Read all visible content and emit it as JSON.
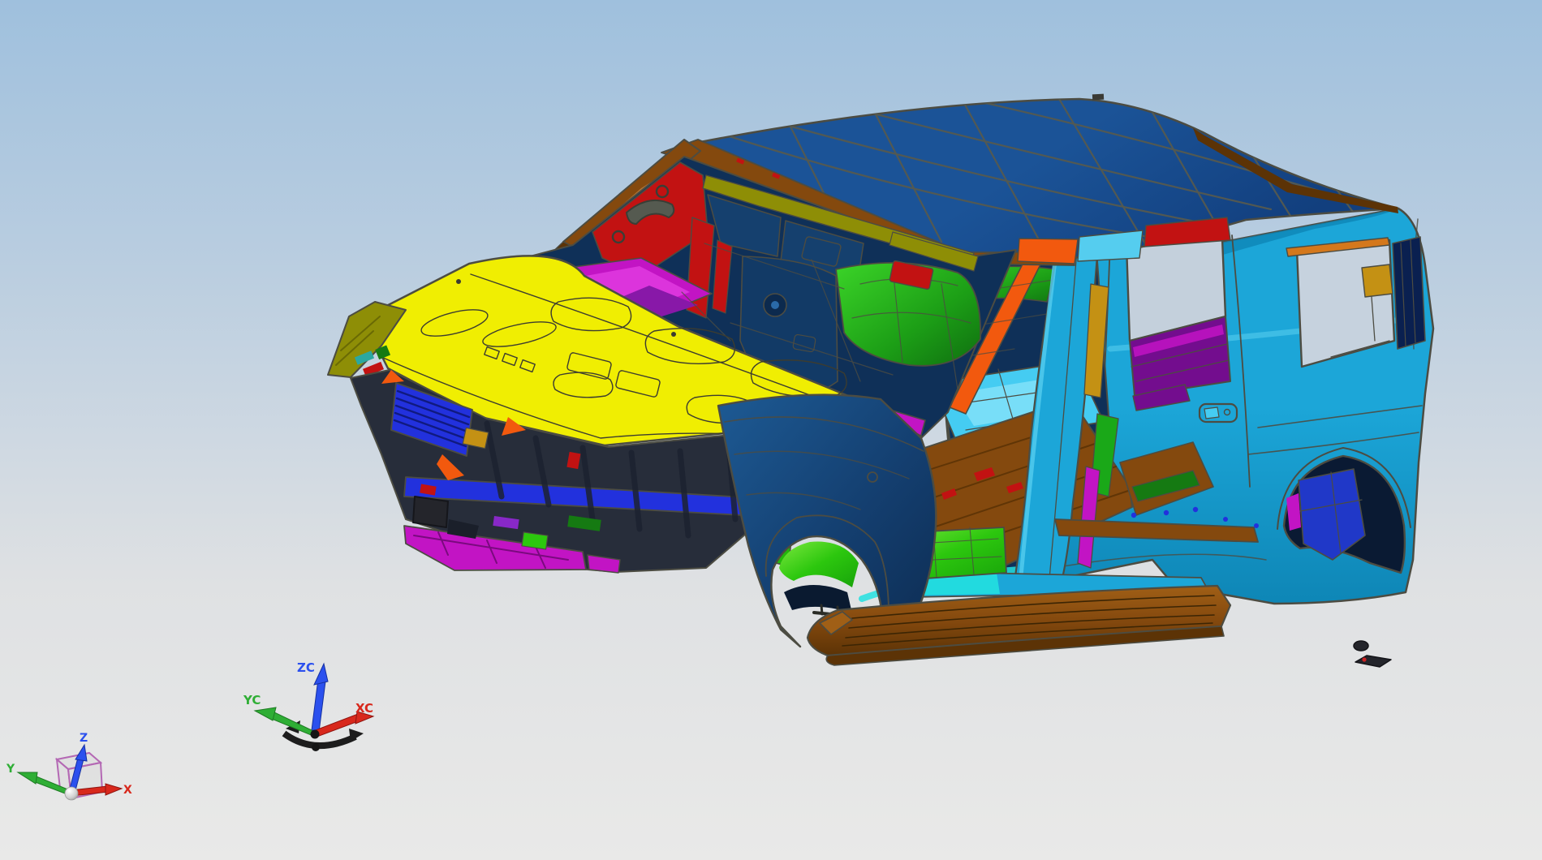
{
  "app": {
    "type": "3d-cad-viewport",
    "render_style": "shaded-with-edges"
  },
  "scene": {
    "description": "SUV body-in-white CAD assembly with multicolored sheet-metal panels, viewed in three-quarter front-left perspective"
  },
  "wcs_triad": {
    "x_label": "XC",
    "y_label": "YC",
    "z_label": "ZC"
  },
  "view_triad": {
    "x_label": "X",
    "y_label": "Y",
    "z_label": "Z"
  },
  "palette": {
    "bg_top": "#9fc0dd",
    "bg_upper": "#b9cde0",
    "bg_lower": "#dfe1e3",
    "bg_bottom": "#e9e9e8",
    "axis_x": "#d8281c",
    "axis_y": "#2fae35",
    "axis_z": "#2b50ee",
    "cube_wire": "#b468b4",
    "cube_fill": "#d9d9d9",
    "edge": "#4c4c42",
    "edge_soft": "#565a50",
    "roof_blue": "#1b5397",
    "roof_blue_dark": "#123f7e",
    "body_cyan": "#1ca6d8",
    "body_cyan_light": "#55cdef",
    "body_cyan_dark": "#0e86b6",
    "hood_yellow": "#f0ee02",
    "fender_navy": "#143f70",
    "interior_navy": "#0f3058",
    "brown": "#84490e",
    "brown_light": "#c08040",
    "brown_dark": "#5c3306",
    "orange": "#f2590e",
    "red": "#c21212",
    "magenta": "#c214c4",
    "purple_deep": "#730d8e",
    "green_bright": "#2cc70e",
    "green_dark": "#157a12",
    "olive": "#8e8e06",
    "gold": "#c49114",
    "blue_bright": "#2231dd",
    "wheelhouse_blue": "#2038c8",
    "cyan_floor": "#45ccf2",
    "teal_sill": "#24e0e0",
    "dark_part": "#24252b",
    "origin_ball": "#f2f2f2"
  }
}
